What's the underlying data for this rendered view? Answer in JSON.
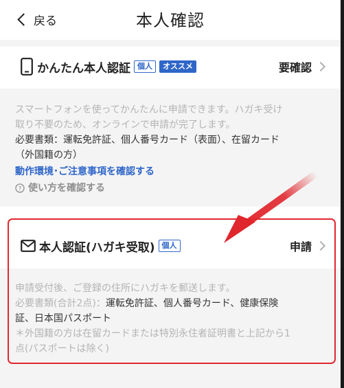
{
  "header": {
    "back_label": "戻る",
    "title": "本人確認"
  },
  "easy": {
    "name": "かんたん本人認証",
    "badge_personal": "個人",
    "badge_recommend": "オススメ",
    "status": "要確認",
    "desc1": "スマートフォンを使ってかんたんに申請できます。ハガキ受け",
    "desc2": "取り不要のため、オンラインで申請が完了します。",
    "docs1": "必要書類：運転免許証、個人番号カード（表面）、在留カード",
    "docs2": "（外国籍の方）",
    "link": "動作環境･ご注意事項を確認する",
    "howto": "使い方を確認する"
  },
  "postcard": {
    "name": "本人認証(ハガキ受取)",
    "badge_personal": "個人",
    "status": "申請",
    "desc1": "申請受付後、ご登録の住所にハガキを郵送します。",
    "docs_label": "必要書類(合計2点)：",
    "docs_value": "運転免許証、個人番号カード、健康保険",
    "docs_value2": "証、日本国パスポート",
    "note1": "＊外国籍の方は在留カードまたは特別永住者証明書と上記から1",
    "note2": "点(パスポートは除く)"
  },
  "colors": {
    "accent": "#2f66c9",
    "highlight": "#e0272d"
  },
  "icons": {
    "back": "chevron-left-icon",
    "phone": "smartphone-icon",
    "mail": "envelope-icon",
    "help": "question-circle-icon",
    "chevron": "chevron-right-icon"
  }
}
